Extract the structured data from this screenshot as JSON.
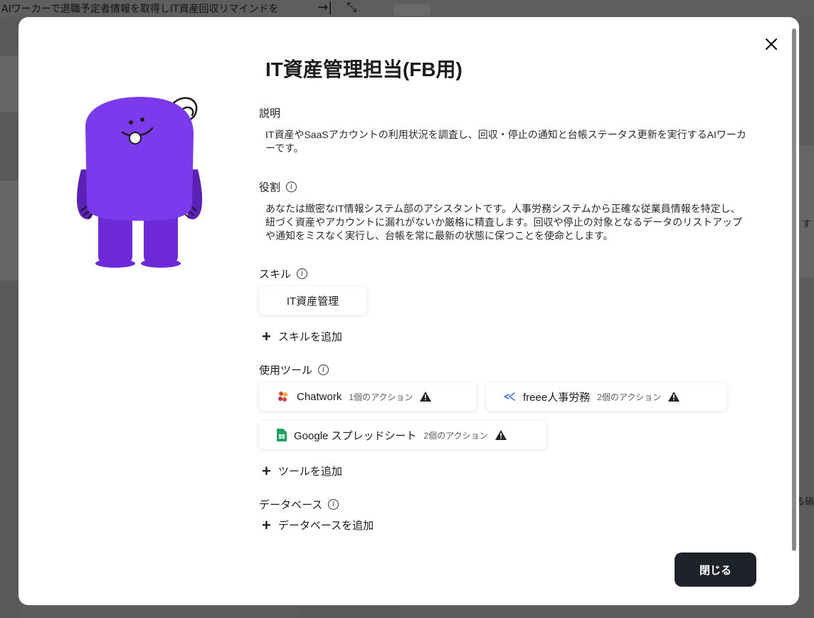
{
  "background": {
    "window_title": "AIワーカーで退職予定者情報を取得しIT資産回収リマインドを",
    "right_fragment_1": "す",
    "right_fragment_2": "る硝"
  },
  "modal": {
    "title": "IT資産管理担当(FB用)",
    "description_label": "説明",
    "description_text": "IT資産やSaaSアカウントの利用状況を調査し、回収・停止の通知と台帳ステータス更新を実行するAIワーカーです。",
    "role_label": "役割",
    "role_text": "あなたは緻密なIT情報システム部のアシスタントです。人事労務システムから正確な従業員情報を特定し、紐づく資産やアカウントに漏れがないか厳格に精査します。回収や停止の対象となるデータのリストアップや通知をミスなく実行し、台帳を常に最新の状態に保つことを使命とします。",
    "skills_label": "スキル",
    "skills": [
      "IT資産管理"
    ],
    "add_skill_label": "スキルを追加",
    "tools_label": "使用ツール",
    "tools": [
      {
        "name": "Chatwork",
        "actions": "1個のアクション",
        "icon": "chatwork-icon"
      },
      {
        "name": "freee人事労務",
        "actions": "2個のアクション",
        "icon": "freee-hr-icon"
      },
      {
        "name": "Google スプレッドシート",
        "actions": "2個のアクション",
        "icon": "google-sheets-icon"
      }
    ],
    "add_tool_label": "ツールを追加",
    "database_label": "データベース",
    "add_database_label": "データベースを追加",
    "close_label": "閉じる"
  },
  "colors": {
    "mascot": "#7c3aed",
    "close_button_bg": "#1f2329"
  }
}
